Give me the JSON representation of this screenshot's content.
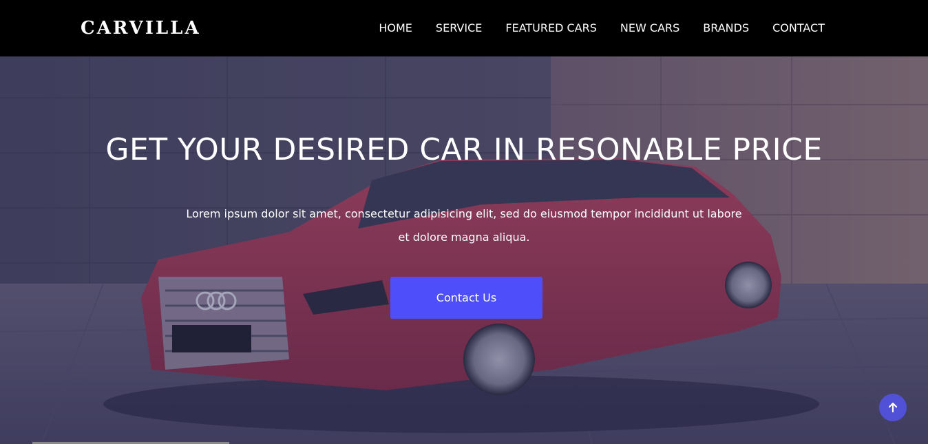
{
  "brand": {
    "logo_text": "CARVILLA"
  },
  "nav": {
    "items": [
      {
        "label": "HOME"
      },
      {
        "label": "SERVICE"
      },
      {
        "label": "FEATURED CARS"
      },
      {
        "label": "NEW CARS"
      },
      {
        "label": "BRANDS"
      },
      {
        "label": "CONTACT"
      }
    ]
  },
  "hero": {
    "title": "GET YOUR DESIRED CAR IN RESONABLE PRICE",
    "description": "Lorem ipsum dolor sit amet, consectetur adipisicing elit, sed do eiusmod tempor incididunt ut labore et dolore magna aliqua.",
    "cta_label": "Contact Us"
  },
  "scroll_top": {
    "icon": "arrow-up-icon"
  },
  "colors": {
    "navbar": "#000000",
    "accent": "#4e4ffa",
    "scroll_button": "#5051d6",
    "car_body": "#b83b52"
  }
}
